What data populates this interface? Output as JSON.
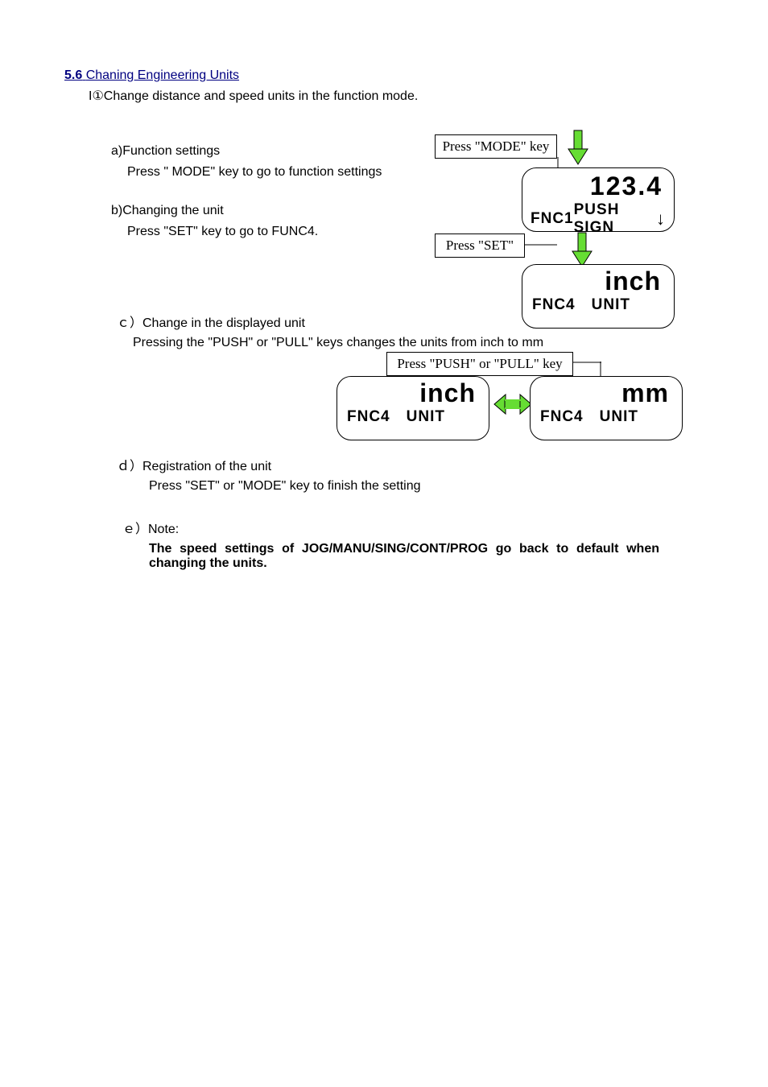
{
  "section": {
    "num": "5.6",
    "title": "Chaning Engineering Units"
  },
  "intro": "I①Change distance and speed units in the function mode.",
  "steps": {
    "a": {
      "label": "a)Function settings",
      "sub": "Press \" MODE\" key to go to function settings"
    },
    "b": {
      "label": "b)Changing the unit",
      "sub": "Press \"SET\" key to go to FUNC4."
    },
    "c": {
      "label": "ｃ）Change in the displayed unit",
      "sub": "Pressing the \"PUSH\" or \"PULL\" keys changes the units from inch to mm"
    },
    "d": {
      "label": "ｄ）Registration of the unit",
      "sub": "Press \"SET\" or \"MODE\" key to finish the setting"
    },
    "e": {
      "label": "ｅ）Note:",
      "sub": "The speed settings of JOG/MANU/SING/CONT/PROG go back to default when changing the units."
    }
  },
  "boxes": {
    "mode": "Press \"MODE\" key",
    "set": "Press \"SET\"",
    "pushpull": "Press \"PUSH\" or \"PULL\" key"
  },
  "lcd1": {
    "value": "123.4",
    "fnc": "FNC1",
    "label": "PUSH SIGN",
    "arrow": "↓"
  },
  "lcd2": {
    "unit": "inch",
    "fnc": "FNC4",
    "label": "UNIT"
  },
  "lcd3": {
    "unit": "inch",
    "fnc": "FNC4",
    "label": "UNIT"
  },
  "lcd4": {
    "unit": "mm",
    "fnc": "FNC4",
    "label": "UNIT"
  }
}
